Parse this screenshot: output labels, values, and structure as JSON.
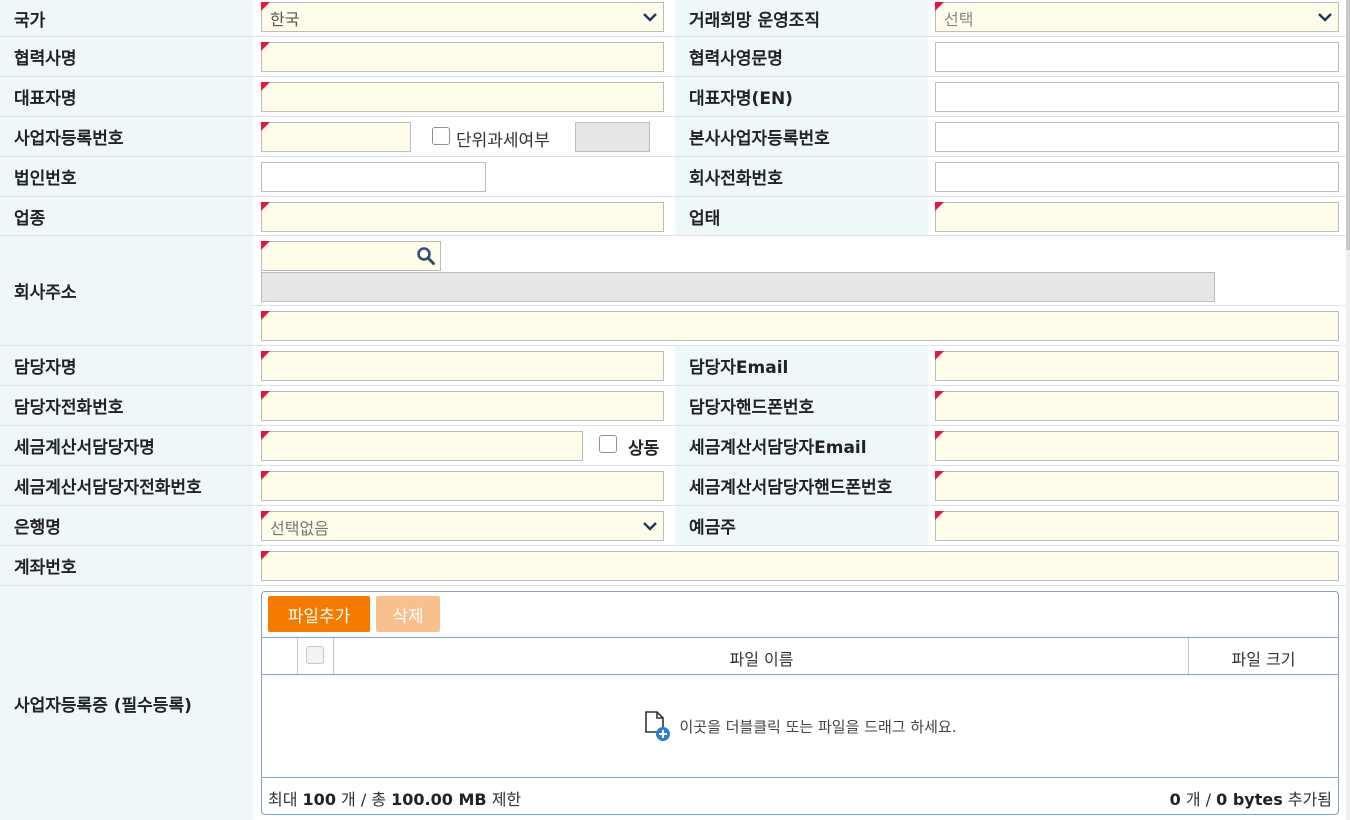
{
  "rows": {
    "country": {
      "label": "국가",
      "value": "한국"
    },
    "trade_org": {
      "label": "거래희망 운영조직",
      "value": "선택"
    },
    "partner_name": {
      "label": "협력사명"
    },
    "partner_name_en": {
      "label": "협력사영문명"
    },
    "ceo_name": {
      "label": "대표자명"
    },
    "ceo_name_en": {
      "label": "대표자명(EN)"
    },
    "biz_no": {
      "label": "사업자등록번호",
      "unit_tax_label": "단위과세여부"
    },
    "hq_biz_no": {
      "label": "본사사업자등록번호"
    },
    "corp_no": {
      "label": "법인번호"
    },
    "company_phone": {
      "label": "회사전화번호"
    },
    "business_type": {
      "label": "업종"
    },
    "business_category": {
      "label": "업태"
    },
    "address": {
      "label": "회사주소"
    },
    "manager_name": {
      "label": "담당자명"
    },
    "manager_email": {
      "label": "담당자Email"
    },
    "manager_phone": {
      "label": "담당자전화번호"
    },
    "manager_mobile": {
      "label": "담당자핸드폰번호"
    },
    "tax_manager_name": {
      "label": "세금계산서담당자명",
      "same_label": "상동"
    },
    "tax_manager_email": {
      "label": "세금계산서담당자Email"
    },
    "tax_manager_phone": {
      "label": "세금계산서담당자전화번호"
    },
    "tax_manager_mobile": {
      "label": "세금계산서담당자핸드폰번호"
    },
    "bank": {
      "label": "은행명",
      "value": "선택없음"
    },
    "depositor": {
      "label": "예금주"
    },
    "account_no": {
      "label": "계좌번호"
    },
    "biz_cert": {
      "label": "사업자등록증 (필수등록)"
    }
  },
  "uploader": {
    "add_button": "파일추가",
    "delete_button": "삭제",
    "col_name": "파일 이름",
    "col_size": "파일 크기",
    "empty_hint": "이곳을 더블클릭 또는 파일을 드래그 하세요.",
    "limit_prefix": "최대",
    "limit_count": "100",
    "limit_mid": "개 / 총",
    "limit_size": "100.00 MB",
    "limit_suffix": "제한",
    "added_count": "0",
    "added_mid": "개 /",
    "added_size": "0 bytes",
    "added_suffix": "추가됨"
  },
  "colors": {
    "label_bg": "#eef8fb",
    "required_bg": "#fffdea",
    "required_marker": "#e5163e",
    "accent_orange": "#f47a00",
    "border_blue": "#7ea4cf"
  },
  "icons": [
    "chevron-down-icon",
    "search-icon",
    "file-add-icon",
    "checkbox-icon"
  ]
}
